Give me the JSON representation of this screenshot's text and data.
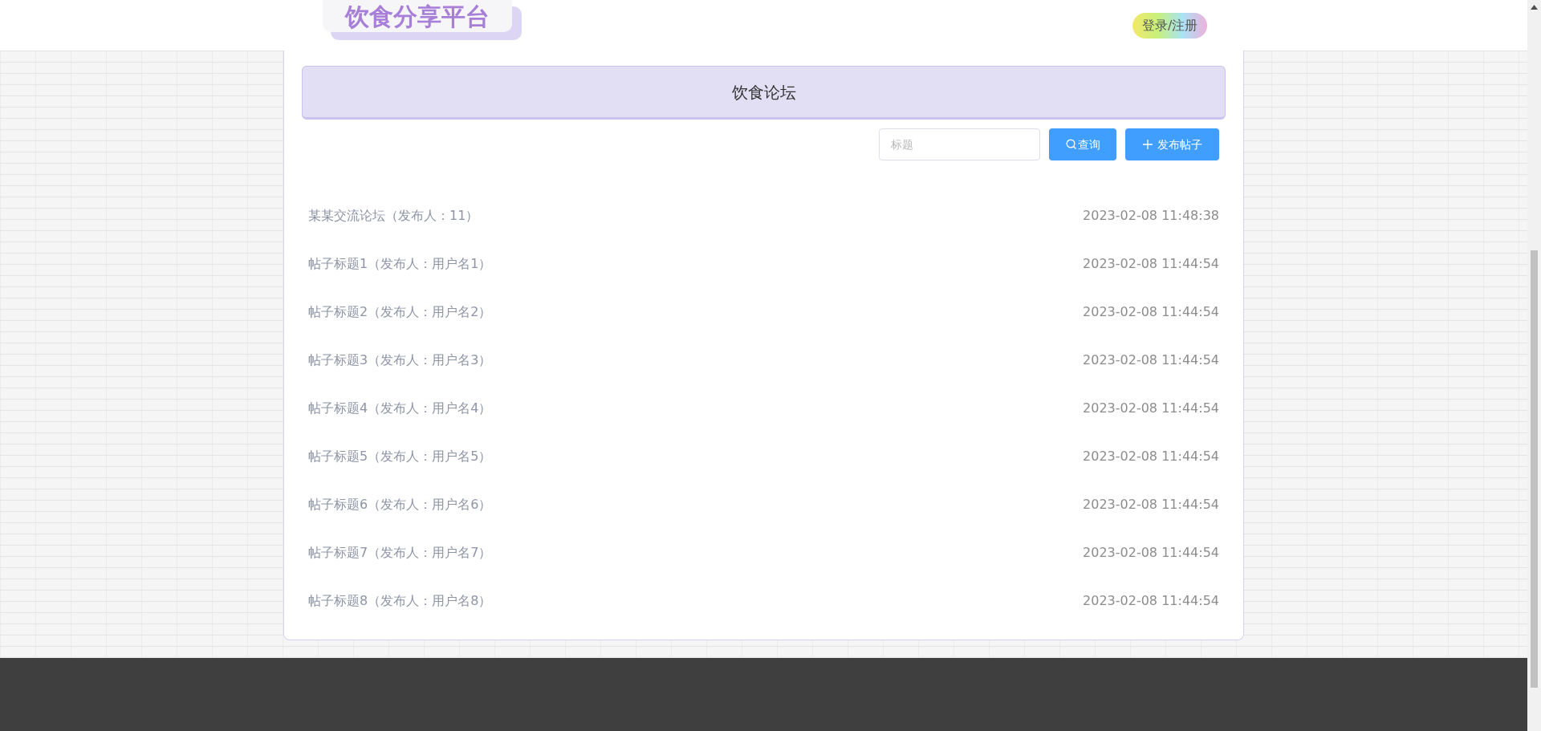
{
  "header": {
    "logo": "饮食分享平台",
    "login_button": "登录/注册"
  },
  "forum": {
    "title": "饮食论坛",
    "search": {
      "placeholder": "标题"
    },
    "search_button": "查询",
    "post_button": "发布帖子",
    "posts": [
      {
        "title": "某某交流论坛（发布人：11）",
        "time": "2023-02-08 11:48:38"
      },
      {
        "title": "帖子标题1（发布人：用户名1）",
        "time": "2023-02-08 11:44:54"
      },
      {
        "title": "帖子标题2（发布人：用户名2）",
        "time": "2023-02-08 11:44:54"
      },
      {
        "title": "帖子标题3（发布人：用户名3）",
        "time": "2023-02-08 11:44:54"
      },
      {
        "title": "帖子标题4（发布人：用户名4）",
        "time": "2023-02-08 11:44:54"
      },
      {
        "title": "帖子标题5（发布人：用户名5）",
        "time": "2023-02-08 11:44:54"
      },
      {
        "title": "帖子标题6（发布人：用户名6）",
        "time": "2023-02-08 11:44:54"
      },
      {
        "title": "帖子标题7（发布人：用户名7）",
        "time": "2023-02-08 11:44:54"
      },
      {
        "title": "帖子标题8（发布人：用户名8）",
        "time": "2023-02-08 11:44:54"
      }
    ]
  }
}
